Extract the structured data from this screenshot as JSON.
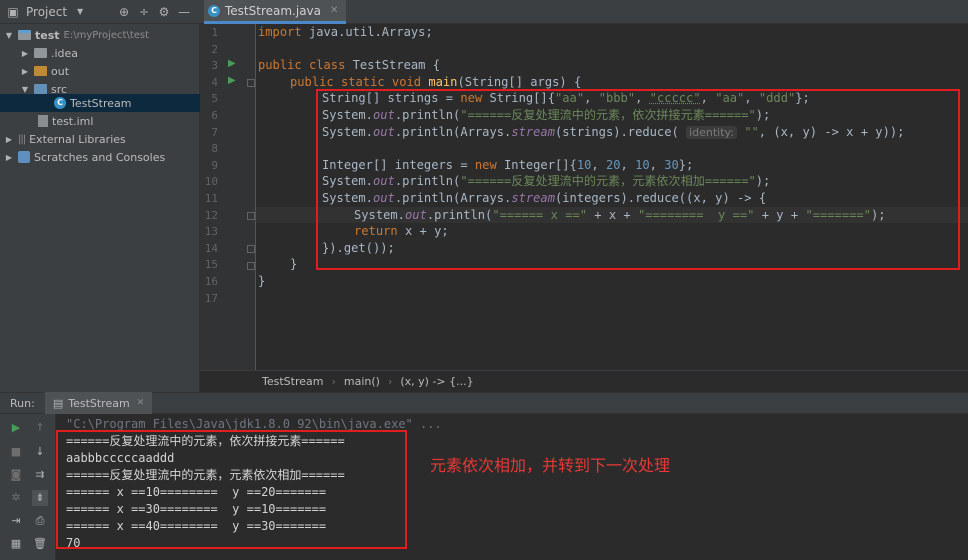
{
  "project_panel": {
    "title": "Project",
    "icons": [
      "target-icon",
      "split-icon",
      "gear-icon",
      "minimize-icon"
    ]
  },
  "editor_tab": {
    "label": "TestStream.java",
    "icon": "java-class-icon"
  },
  "tree": {
    "root": {
      "label": "test",
      "path": "E:\\myProject\\test"
    },
    "idea": "idea",
    "out": "out",
    "src": "src",
    "class_file": "TestStream",
    "iml": "test.iml",
    "ext_libs": "External Libraries",
    "scratches": "Scratches and Consoles"
  },
  "line_numbers": [
    "1",
    "2",
    "3",
    "4",
    "5",
    "6",
    "7",
    "8",
    "9",
    "10",
    "11",
    "12",
    "13",
    "14",
    "15",
    "16",
    "17"
  ],
  "code": {
    "l1_import": "import",
    "l1_rest": " java.util.Arrays;",
    "l3_kw": "public class",
    "l3_rest": " TestStream {",
    "l4_kw": "public static void",
    "l4_fn": "main",
    "l4_rest": "(String[] args) {",
    "l5_a": "String[] strings = ",
    "l5_new": "new",
    "l5_b": " String[]{",
    "l5_s1": "\"aa\"",
    "l5_s2": "\"bbb\"",
    "l5_s3": "\"ccccc\"",
    "l5_s4": "\"aa\"",
    "l5_s5": "\"ddd\"",
    "l5_end": "};",
    "sys": "System.",
    "out": "out",
    "println": ".println(",
    "l6_str": "\"======反复处理流中的元素，依次拼接元素======\"",
    "close": ");",
    "l7_a": ".println(Arrays.",
    "stream": "stream",
    "l7_b": "(strings).reduce(",
    "l7_hint": "identity:",
    "l7_str": "\"\"",
    "l7_c": ", (x, y) -> x + y));",
    "l9_a": "Integer[] integers = ",
    "l9_b": " Integer[]{",
    "n10": "10",
    "n20": "20",
    "n30": "30",
    "l11_str": "\"======反复处理流中的元素，元素依次相加======\"",
    "l12_b": "(integers).reduce((x, y) -> {",
    "l13_s1": "\"====== x ==\"",
    "l13_mid1": " + x + ",
    "l13_s2": "\"========  y ==\"",
    "l13_mid2": " + y + ",
    "l13_s3": "\"=======\"",
    "l14_kw": "return",
    "l14_rest": " x + y;",
    "l15": "}).get());",
    "l16": "}",
    "l17": "}"
  },
  "breadcrumb": [
    "TestStream",
    "main()",
    "(x, y) -> {...}"
  ],
  "run_panel": {
    "label": "Run:",
    "tab": "TestStream"
  },
  "console": {
    "command": "\"C:\\Program Files\\Java\\jdk1.8.0_92\\bin\\java.exe\" ...",
    "lines": [
      "======反复处理流中的元素，依次拼接元素======",
      "aabbbcccccaaddd",
      "======反复处理流中的元素，元素依次相加======",
      "====== x ==10========  y ==20=======",
      "====== x ==30========  y ==10=======",
      "====== x ==40========  y ==30=======",
      "70"
    ]
  },
  "annotation": "元素依次相加，并转到下一次处理",
  "colors": {
    "highlight_box": "#e11d1d",
    "keyword": "#cc7832",
    "string": "#6a8759",
    "number": "#6897bb"
  }
}
